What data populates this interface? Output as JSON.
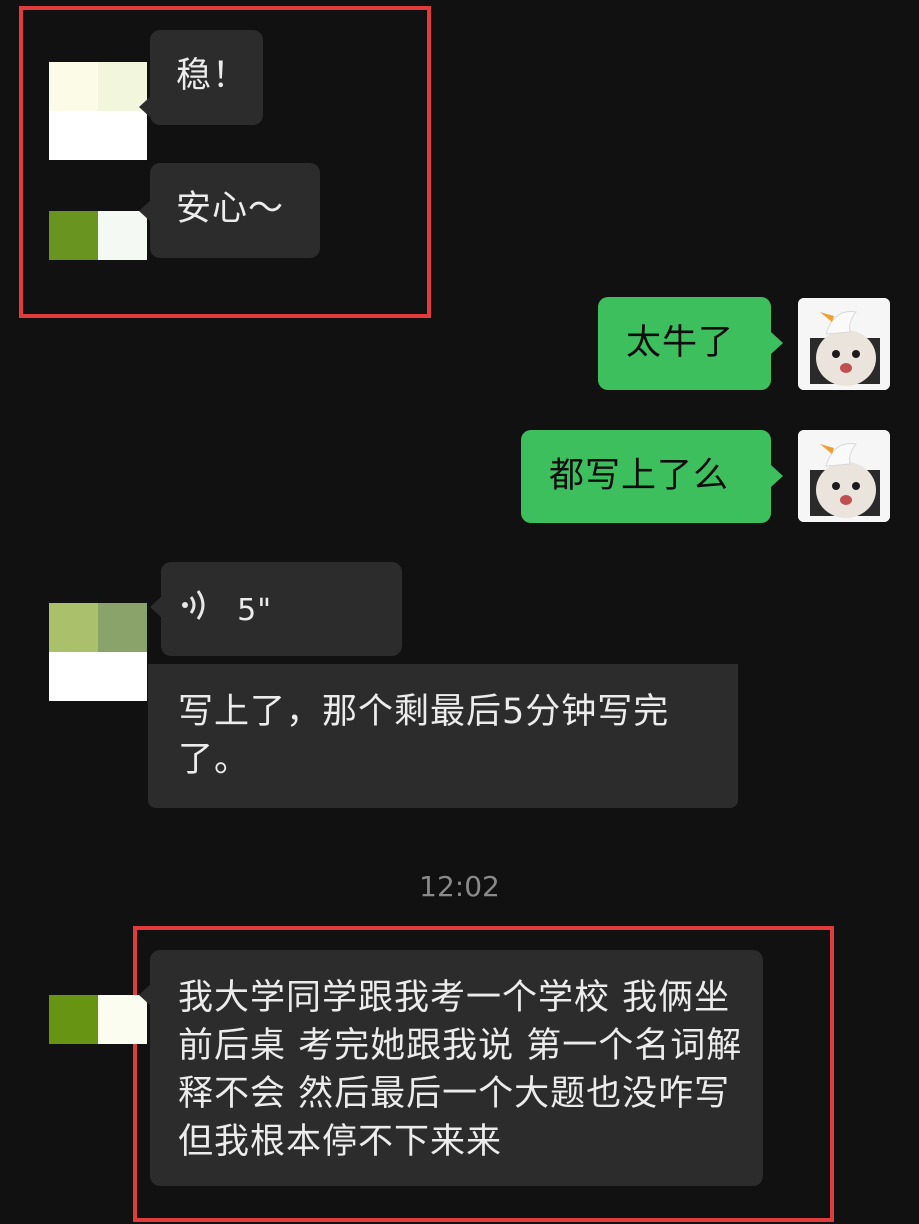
{
  "messages": {
    "m1": "稳！",
    "m2": "安心～",
    "m3": "太牛了",
    "m4": "都写上了么",
    "voice_duration": "5\"",
    "m5": "写上了，那个剩最后5分钟写完了。",
    "timestamp": "12:02",
    "m6": "我大学同学跟我考一个学校 我俩坐前后桌 考完她跟我说 第一个名词解释不会 然后最后一个大题也没咋写 但我根本停不下来来"
  },
  "colors": {
    "background": "#111111",
    "incoming_bubble": "#2c2c2c",
    "outgoing_bubble": "#3dbf5e",
    "highlight_border": "#e23b3b"
  },
  "icons": {
    "voice": "voice-wave-icon",
    "self_avatar": "cat-with-goose-hat-avatar"
  }
}
